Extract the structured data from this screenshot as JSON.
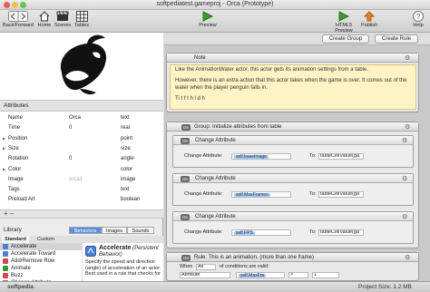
{
  "window": {
    "title": "softpediatest.gameproj - Orca (Prototype)"
  },
  "toolbar": {
    "back_forward": "Back/Forward",
    "home": "Home",
    "scenes": "Scenes",
    "tables": "Tables",
    "preview": "Preview",
    "html5_preview": "HTML5 Preview",
    "publish": "Publish",
    "help": "Help"
  },
  "attributes": {
    "title": "Attributes",
    "rows": [
      {
        "name": "Name",
        "value": "Orca",
        "type": "text",
        "expandable": false
      },
      {
        "name": "Time",
        "value": "0",
        "type": "real",
        "expandable": false
      },
      {
        "name": "Position",
        "value": "",
        "type": "point",
        "expandable": true
      },
      {
        "name": "Size",
        "value": "",
        "type": "size",
        "expandable": true
      },
      {
        "name": "Rotation",
        "value": "0",
        "type": "angle",
        "expandable": false
      },
      {
        "name": "Color",
        "value": "",
        "type": "color",
        "expandable": true
      },
      {
        "name": "Image",
        "value": "orca1",
        "type": "image",
        "expandable": false
      },
      {
        "name": "Tags",
        "value": "",
        "type": "text",
        "expandable": false
      },
      {
        "name": "Preload Art",
        "value": "",
        "type": "boolean",
        "expandable": false
      }
    ],
    "add_remove": "+ –"
  },
  "library": {
    "title": "Library",
    "tabs": [
      "Behaviors",
      "Images",
      "Sounds"
    ],
    "active_tab": "Behaviors",
    "subtabs": [
      "Standard",
      "Custom"
    ],
    "items": [
      {
        "label": "Accelerate",
        "color": "#4a7fd1",
        "selected": true
      },
      {
        "label": "Accelerate Toward",
        "color": "#4a7fd1",
        "selected": false
      },
      {
        "label": "Add/Remove Row",
        "color": "#d14a4a",
        "selected": false
      },
      {
        "label": "Animate",
        "color": "#2e9a3a",
        "selected": false
      },
      {
        "label": "Buzz",
        "color": "#d14a4a",
        "selected": false
      },
      {
        "label": "Change Attribute",
        "color": "#d14a4a",
        "selected": false
      },
      {
        "label": "Change Image",
        "color": "#d14a4a",
        "selected": false
      }
    ],
    "detail_title": "Accelerate",
    "detail_subtitle": "(Persistent Behavior)",
    "detail_text": "Specify the speed and direction (angle) of acceleration of an actor. Best used in a rule that checks for"
  },
  "editor": {
    "create_group": "Create Group",
    "create_rule": "Create Rule",
    "note": {
      "title": "Note",
      "text1": "Like the AnimationWater actor, this actor gets its animation settings from a table.",
      "text2": "However, there is an extra action that this actor takes when the game is over. It comes out of the water when the player penguin falls in.",
      "text3": "Ti t f t h l d h"
    },
    "group": {
      "on": "On",
      "title": "Group: Initialize attributes from table",
      "actions": [
        {
          "title": "Change Attribute",
          "label": "Change Attribute:",
          "attr": "self.baseImage",
          "to": "To:",
          "value": "tableCellValue(ga"
        },
        {
          "title": "Change Attribute",
          "label": "Change Attribute:",
          "attr": "self.MaxFrames",
          "to": "To:",
          "value": "tableCellValue(ga"
        },
        {
          "title": "Change Attribute",
          "label": "Change Attribute:",
          "attr": "self.FPS",
          "to": "To:",
          "value": "tableCellValue(ga"
        }
      ]
    },
    "rule": {
      "on": "On",
      "title": "Rule: This is an animation. (more than one frame)",
      "when": "When",
      "all": "All",
      "cond_text": "of conditions are valid:",
      "attribute": "Attribute",
      "attr_value": "self.MaxFra",
      "op": ">",
      "num": "1"
    }
  },
  "status": {
    "left": "softpedia",
    "project_size": "Project Size: 1.2 MB"
  },
  "colors": {
    "accent_blue": "#a9c9f2",
    "note_bg": "#fdf3c4",
    "preview_green": "#3b9b2f",
    "publish_orange": "#e8802a"
  }
}
